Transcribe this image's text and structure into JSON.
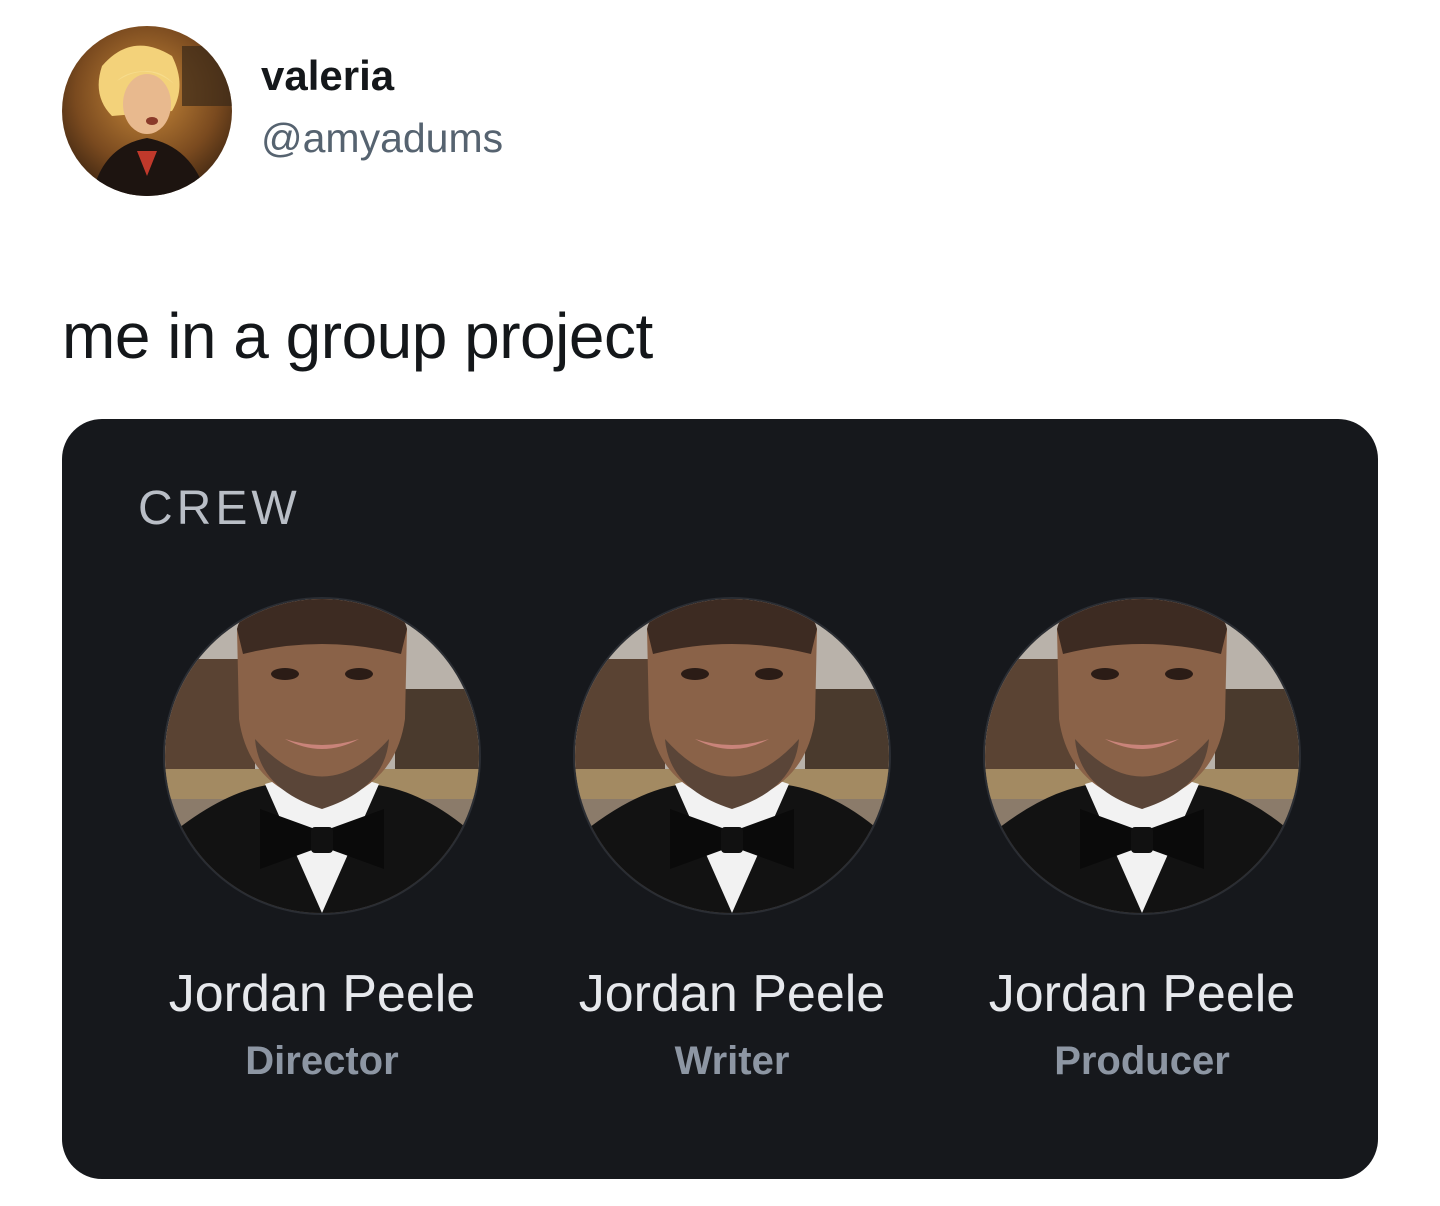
{
  "tweet": {
    "author": {
      "display_name": "valeria",
      "handle": "@amyadums",
      "avatar_icon": "profile-photo"
    },
    "text": "me in a group project"
  },
  "crew_card": {
    "heading": "CREW",
    "background": "#16181c",
    "members": [
      {
        "name": "Jordan Peele",
        "role": "Director",
        "photo_icon": "headshot-photo"
      },
      {
        "name": "Jordan Peele",
        "role": "Writer",
        "photo_icon": "headshot-photo"
      },
      {
        "name": "Jordan Peele",
        "role": "Producer",
        "photo_icon": "headshot-photo"
      }
    ]
  }
}
